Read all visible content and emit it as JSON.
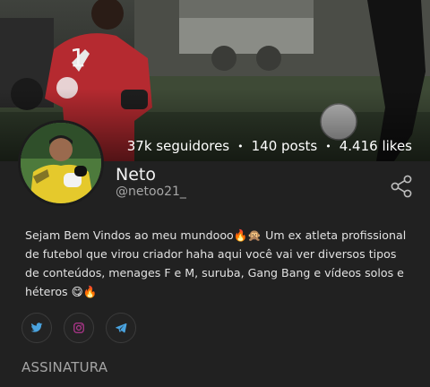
{
  "profile": {
    "name": "Neto",
    "handle": "@netoo21_"
  },
  "stats": {
    "followers": "37k seguidores",
    "posts": "140 posts",
    "likes": "4.416 likes",
    "separator": "•"
  },
  "bio": {
    "text": "Sejam Bem Vindos ao meu mundooo🔥🙊 Um ex atleta profissional de futebol que virou criador haha aqui você vai ver diversos tipos de conteúdos, menages F e M, suruba, Gang Bang e vídeos solos e héteros 😋🔥"
  },
  "cover": {
    "jersey_number": "1"
  },
  "social_links": [
    {
      "icon": "twitter-icon",
      "color": "#4aa3df"
    },
    {
      "icon": "instagram-icon",
      "color": "#b0368d"
    },
    {
      "icon": "telegram-icon",
      "color": "#4aa3df"
    }
  ],
  "subscription_section": {
    "label": "ASSINATURA"
  },
  "colors": {
    "background": "#212121",
    "text_primary": "#f2f2f2",
    "text_secondary": "#a7a7a7"
  }
}
